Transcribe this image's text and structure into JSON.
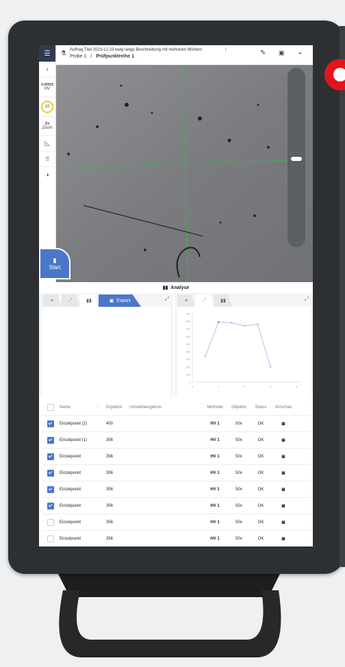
{
  "header": {
    "order_title": "Auftrag Titel 2023-12-23 ewig lange Beschreibung mit mehreren Wörtern",
    "breadcrumb_sample": "Probe 1",
    "breadcrumb_separator": "/",
    "breadcrumb_series": "Prüfpunktreihe 1"
  },
  "sidebar": {
    "value": "0.00025",
    "unit": "HV",
    "objective": "10",
    "zoom_value": "2x",
    "zoom_label": "Zoom"
  },
  "camera": {
    "start_label": "Start",
    "controls": [
      "5",
      "2x"
    ]
  },
  "analyse": {
    "title": "Analyse",
    "export_label": "Export"
  },
  "chart_data": {
    "type": "line",
    "x": [
      0.5,
      1,
      1.5,
      2,
      2.5,
      3,
      3.5
    ],
    "y": [
      340,
      790,
      780,
      740,
      760,
      200,
      0
    ],
    "xticks": [
      "0",
      "1",
      "2",
      "3",
      "4"
    ],
    "yticks": [
      "0",
      "100",
      "200",
      "300",
      "400",
      "500",
      "600",
      "700",
      "800",
      "900"
    ],
    "ylim": [
      0,
      900
    ],
    "xlim": [
      0,
      4.2
    ],
    "series_color": "#9db4e0"
  },
  "table": {
    "headers": {
      "name": "Name",
      "sort": "↑",
      "result": "Ergebnis",
      "converted": "Umwerteergebnis",
      "method": "Methode",
      "objective": "Objektiv",
      "status": "Status",
      "preview": "Vorschau"
    },
    "rows": [
      {
        "name": "Einzelpunkt (2)",
        "result": "400",
        "method": "HV 1",
        "objective": "50x",
        "status": "OK",
        "checked": true
      },
      {
        "name": "Einzelpunkt (1)",
        "result": "356",
        "method": "HV 1",
        "objective": "50x",
        "status": "OK",
        "checked": true
      },
      {
        "name": "Einzelpunkt",
        "result": "356",
        "method": "HV 1",
        "objective": "50x",
        "status": "OK",
        "checked": true
      },
      {
        "name": "Einzelpunkt",
        "result": "356",
        "method": "HV 1",
        "objective": "50x",
        "status": "OK",
        "checked": true
      },
      {
        "name": "Einzelpunkt",
        "result": "356",
        "method": "HV 1",
        "objective": "50x",
        "status": "OK",
        "checked": true
      },
      {
        "name": "Einzelpunkt",
        "result": "356",
        "method": "HV 1",
        "objective": "50x",
        "status": "OK",
        "checked": true
      },
      {
        "name": "Einzelpunkt",
        "result": "356",
        "method": "HV 1",
        "objective": "50x",
        "status": "OK",
        "checked": false
      },
      {
        "name": "Einzelpunkt",
        "result": "356",
        "method": "HV 1",
        "objective": "50x",
        "status": "OK",
        "checked": false
      }
    ]
  },
  "colors": {
    "accent": "#4c76c9",
    "warning": "#f2c62a",
    "hardware_red": "#e0161c",
    "crosshair": "#3fb83f"
  }
}
